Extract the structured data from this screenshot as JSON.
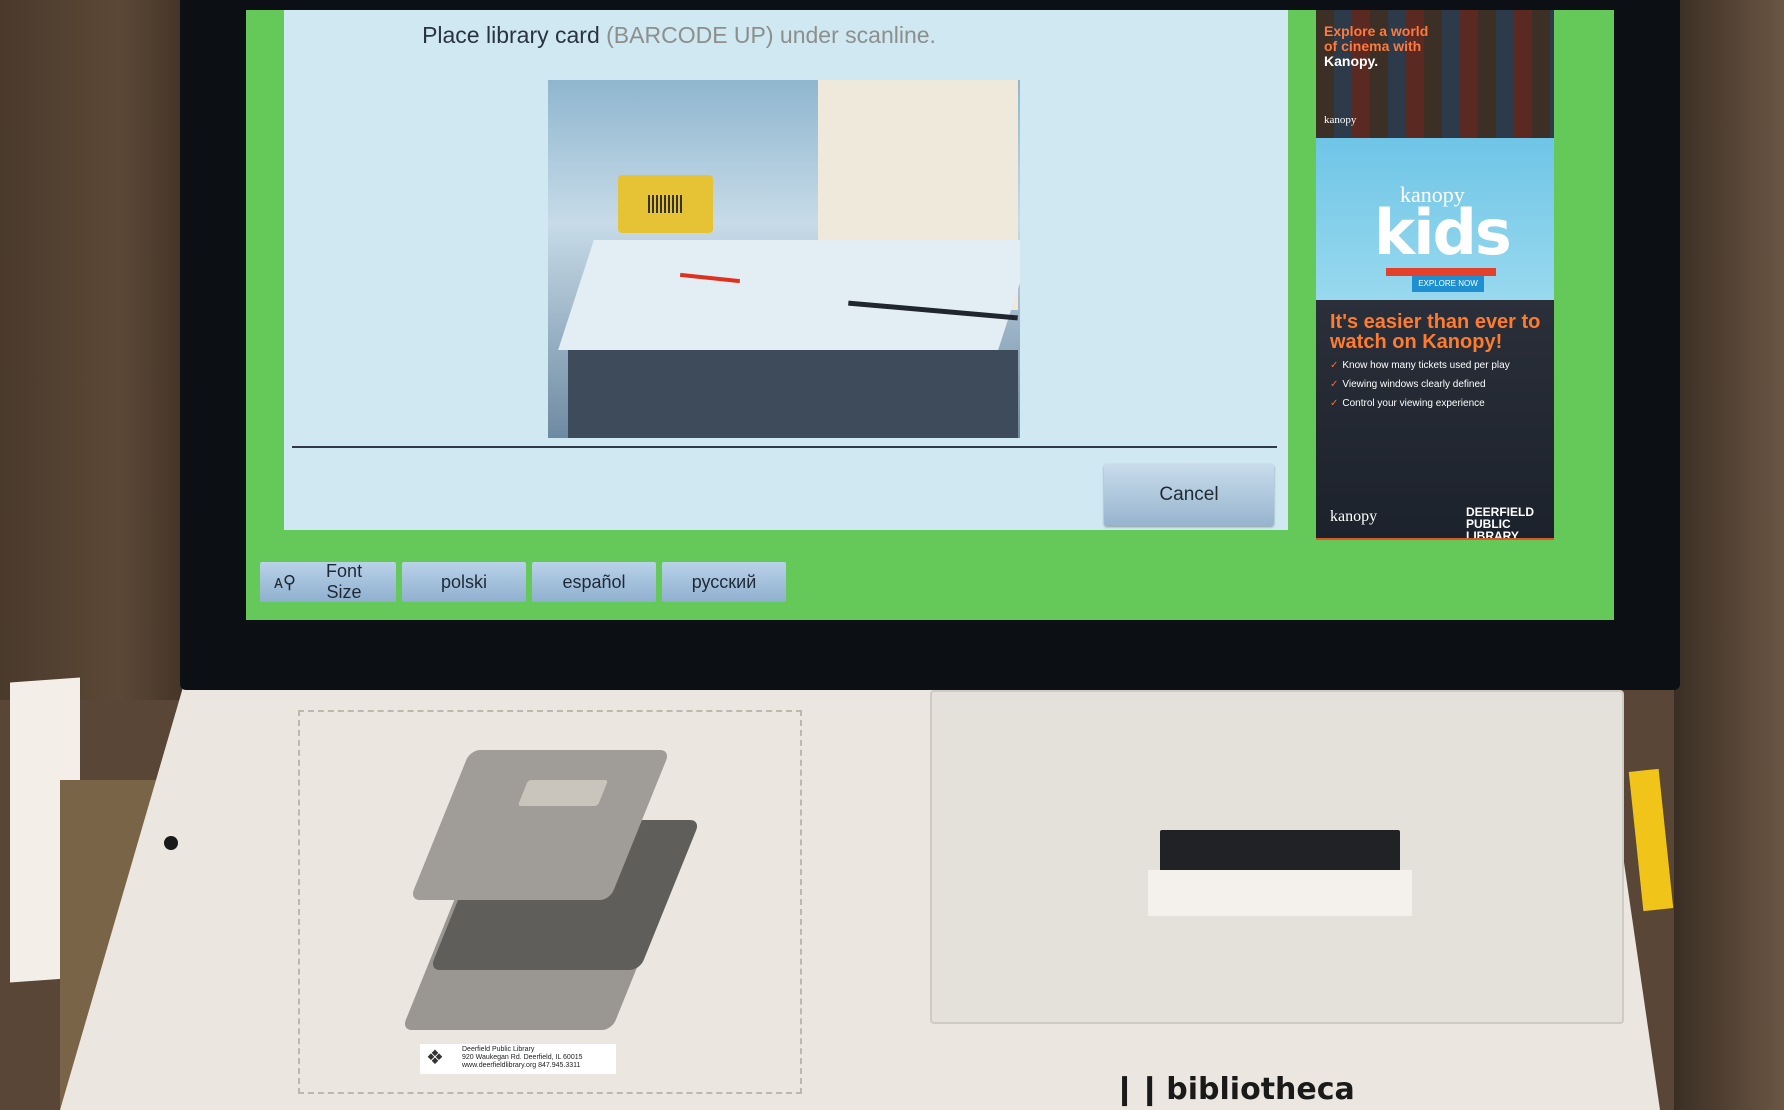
{
  "screen": {
    "instruction_prefix": "Place library card",
    "instruction_highlight": "(BARCODE UP) under scanline.",
    "cancel_label": "Cancel"
  },
  "language_bar": {
    "font_size_label": "Font Size",
    "languages": [
      "polski",
      "español",
      "русский"
    ]
  },
  "ad": {
    "top_text": "Explore a world of cinema with",
    "top_brand": "Kanopy.",
    "top_small_brand": "kanopy",
    "kids_small": "kanopy",
    "kids_word": "kids",
    "explore_button": "EXPLORE NOW",
    "headline": "It's easier than ever to watch on Kanopy!",
    "bullets": [
      "Know how many tickets used per play",
      "Viewing windows clearly defined",
      "Control your viewing experience"
    ],
    "footer_brand": "kanopy",
    "footer_library": "DEERFIELD PUBLIC LIBRARY"
  },
  "kiosk": {
    "sticker_line1": "Deerfield Public Library",
    "sticker_line2": "920 Waukegan Rd. Deerfield, IL 60015",
    "sticker_line3": "www.deerfieldlibrary.org 847.945.3311",
    "maker": "bibliotheca"
  },
  "colors": {
    "screen_bg": "#64c958",
    "panel_bg": "#cfe8f1",
    "button_bg": "#97b4cd",
    "ad_accent": "#ff7b2e"
  }
}
